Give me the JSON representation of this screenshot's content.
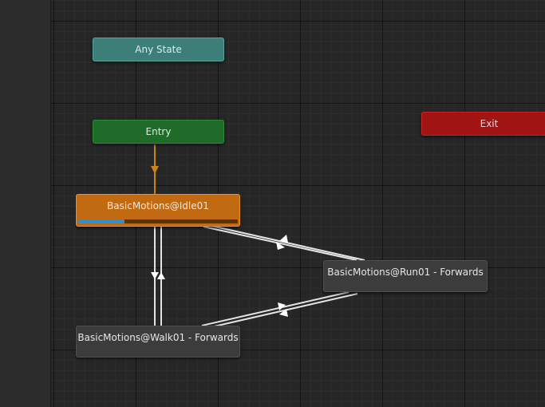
{
  "states": {
    "any_state": {
      "label": "Any State",
      "color": "#3d7f78"
    },
    "entry": {
      "label": "Entry",
      "color": "#1f6b2a"
    },
    "exit": {
      "label": "Exit",
      "color": "#a11414"
    },
    "idle": {
      "label": "BasicMotions@Idle01",
      "color": "#c26a12",
      "playback_progress": 0.29,
      "progress_color": "#2f8fd8"
    },
    "run": {
      "label": "BasicMotions@Run01 - Forwards",
      "color": "#3c3c3c"
    },
    "walk": {
      "label": "BasicMotions@Walk01 - Forwards",
      "color": "#3c3c3c"
    }
  },
  "transitions": [
    {
      "from": "entry",
      "to": "idle",
      "kind": "default"
    },
    {
      "from": "idle",
      "to": "walk"
    },
    {
      "from": "walk",
      "to": "idle"
    },
    {
      "from": "idle",
      "to": "run"
    },
    {
      "from": "run",
      "to": "idle"
    },
    {
      "from": "walk",
      "to": "run"
    },
    {
      "from": "run",
      "to": "walk"
    }
  ],
  "colors": {
    "default_transition": "#c98418",
    "transition": "#e4e4e4",
    "canvas_background": "#262626"
  }
}
